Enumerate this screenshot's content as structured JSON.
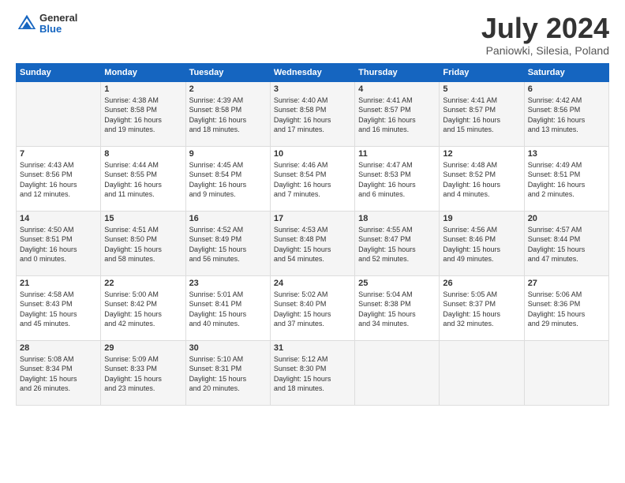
{
  "header": {
    "logo_general": "General",
    "logo_blue": "Blue",
    "title": "July 2024",
    "subtitle": "Paniowki, Silesia, Poland"
  },
  "columns": [
    "Sunday",
    "Monday",
    "Tuesday",
    "Wednesday",
    "Thursday",
    "Friday",
    "Saturday"
  ],
  "weeks": [
    {
      "days": [
        {
          "num": "",
          "info": ""
        },
        {
          "num": "1",
          "info": "Sunrise: 4:38 AM\nSunset: 8:58 PM\nDaylight: 16 hours\nand 19 minutes."
        },
        {
          "num": "2",
          "info": "Sunrise: 4:39 AM\nSunset: 8:58 PM\nDaylight: 16 hours\nand 18 minutes."
        },
        {
          "num": "3",
          "info": "Sunrise: 4:40 AM\nSunset: 8:58 PM\nDaylight: 16 hours\nand 17 minutes."
        },
        {
          "num": "4",
          "info": "Sunrise: 4:41 AM\nSunset: 8:57 PM\nDaylight: 16 hours\nand 16 minutes."
        },
        {
          "num": "5",
          "info": "Sunrise: 4:41 AM\nSunset: 8:57 PM\nDaylight: 16 hours\nand 15 minutes."
        },
        {
          "num": "6",
          "info": "Sunrise: 4:42 AM\nSunset: 8:56 PM\nDaylight: 16 hours\nand 13 minutes."
        }
      ]
    },
    {
      "days": [
        {
          "num": "7",
          "info": "Sunrise: 4:43 AM\nSunset: 8:56 PM\nDaylight: 16 hours\nand 12 minutes."
        },
        {
          "num": "8",
          "info": "Sunrise: 4:44 AM\nSunset: 8:55 PM\nDaylight: 16 hours\nand 11 minutes."
        },
        {
          "num": "9",
          "info": "Sunrise: 4:45 AM\nSunset: 8:54 PM\nDaylight: 16 hours\nand 9 minutes."
        },
        {
          "num": "10",
          "info": "Sunrise: 4:46 AM\nSunset: 8:54 PM\nDaylight: 16 hours\nand 7 minutes."
        },
        {
          "num": "11",
          "info": "Sunrise: 4:47 AM\nSunset: 8:53 PM\nDaylight: 16 hours\nand 6 minutes."
        },
        {
          "num": "12",
          "info": "Sunrise: 4:48 AM\nSunset: 8:52 PM\nDaylight: 16 hours\nand 4 minutes."
        },
        {
          "num": "13",
          "info": "Sunrise: 4:49 AM\nSunset: 8:51 PM\nDaylight: 16 hours\nand 2 minutes."
        }
      ]
    },
    {
      "days": [
        {
          "num": "14",
          "info": "Sunrise: 4:50 AM\nSunset: 8:51 PM\nDaylight: 16 hours\nand 0 minutes."
        },
        {
          "num": "15",
          "info": "Sunrise: 4:51 AM\nSunset: 8:50 PM\nDaylight: 15 hours\nand 58 minutes."
        },
        {
          "num": "16",
          "info": "Sunrise: 4:52 AM\nSunset: 8:49 PM\nDaylight: 15 hours\nand 56 minutes."
        },
        {
          "num": "17",
          "info": "Sunrise: 4:53 AM\nSunset: 8:48 PM\nDaylight: 15 hours\nand 54 minutes."
        },
        {
          "num": "18",
          "info": "Sunrise: 4:55 AM\nSunset: 8:47 PM\nDaylight: 15 hours\nand 52 minutes."
        },
        {
          "num": "19",
          "info": "Sunrise: 4:56 AM\nSunset: 8:46 PM\nDaylight: 15 hours\nand 49 minutes."
        },
        {
          "num": "20",
          "info": "Sunrise: 4:57 AM\nSunset: 8:44 PM\nDaylight: 15 hours\nand 47 minutes."
        }
      ]
    },
    {
      "days": [
        {
          "num": "21",
          "info": "Sunrise: 4:58 AM\nSunset: 8:43 PM\nDaylight: 15 hours\nand 45 minutes."
        },
        {
          "num": "22",
          "info": "Sunrise: 5:00 AM\nSunset: 8:42 PM\nDaylight: 15 hours\nand 42 minutes."
        },
        {
          "num": "23",
          "info": "Sunrise: 5:01 AM\nSunset: 8:41 PM\nDaylight: 15 hours\nand 40 minutes."
        },
        {
          "num": "24",
          "info": "Sunrise: 5:02 AM\nSunset: 8:40 PM\nDaylight: 15 hours\nand 37 minutes."
        },
        {
          "num": "25",
          "info": "Sunrise: 5:04 AM\nSunset: 8:38 PM\nDaylight: 15 hours\nand 34 minutes."
        },
        {
          "num": "26",
          "info": "Sunrise: 5:05 AM\nSunset: 8:37 PM\nDaylight: 15 hours\nand 32 minutes."
        },
        {
          "num": "27",
          "info": "Sunrise: 5:06 AM\nSunset: 8:36 PM\nDaylight: 15 hours\nand 29 minutes."
        }
      ]
    },
    {
      "days": [
        {
          "num": "28",
          "info": "Sunrise: 5:08 AM\nSunset: 8:34 PM\nDaylight: 15 hours\nand 26 minutes."
        },
        {
          "num": "29",
          "info": "Sunrise: 5:09 AM\nSunset: 8:33 PM\nDaylight: 15 hours\nand 23 minutes."
        },
        {
          "num": "30",
          "info": "Sunrise: 5:10 AM\nSunset: 8:31 PM\nDaylight: 15 hours\nand 20 minutes."
        },
        {
          "num": "31",
          "info": "Sunrise: 5:12 AM\nSunset: 8:30 PM\nDaylight: 15 hours\nand 18 minutes."
        },
        {
          "num": "",
          "info": ""
        },
        {
          "num": "",
          "info": ""
        },
        {
          "num": "",
          "info": ""
        }
      ]
    }
  ]
}
